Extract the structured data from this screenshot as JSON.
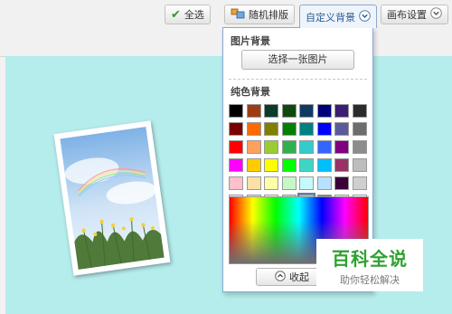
{
  "toolbar": {
    "select_all": "全选",
    "random_layout": "随机排版",
    "custom_bg": "自定义背景",
    "canvas_settings": "画布设置"
  },
  "panel": {
    "image_bg_title": "图片背景",
    "pick_image": "选择一张图片",
    "solid_bg_title": "纯色背景",
    "collapse": "收起",
    "selected_swatch": "#8fd6dc"
  },
  "swatches": [
    [
      "#000000",
      "#9c3e12",
      "#0b3b2a",
      "#0e4a0e",
      "#0f3b63",
      "#00007a",
      "#3b1d72",
      "#2b2b2b"
    ],
    [
      "#7a0000",
      "#ff6a00",
      "#7f7f00",
      "#008000",
      "#008080",
      "#0000ff",
      "#5b5b9b",
      "#6d6d6d"
    ],
    [
      "#ff0000",
      "#ffa060",
      "#9acd32",
      "#2fb24d",
      "#33cccc",
      "#3366ff",
      "#800080",
      "#8c8c8c"
    ],
    [
      "#ff00ff",
      "#ffcc00",
      "#ffff00",
      "#00ff00",
      "#3dd6c5",
      "#00bfff",
      "#993366",
      "#bdbdbd"
    ],
    [
      "#ffc0cb",
      "#fde0a8",
      "#ffffa8",
      "#c6f7c6",
      "#c6fafa",
      "#b8e1ff",
      "#3a003a",
      "#cfcfcf"
    ],
    [
      "#ffe0e8",
      "#f3d3b0",
      "#fffccf",
      "#a6f0a6",
      "#8fd6dc",
      "#5d7f8a",
      "#e5e5f8",
      "#ffffff"
    ]
  ],
  "watermark": {
    "line1": "百科全说",
    "line2": "助你轻松解决"
  }
}
